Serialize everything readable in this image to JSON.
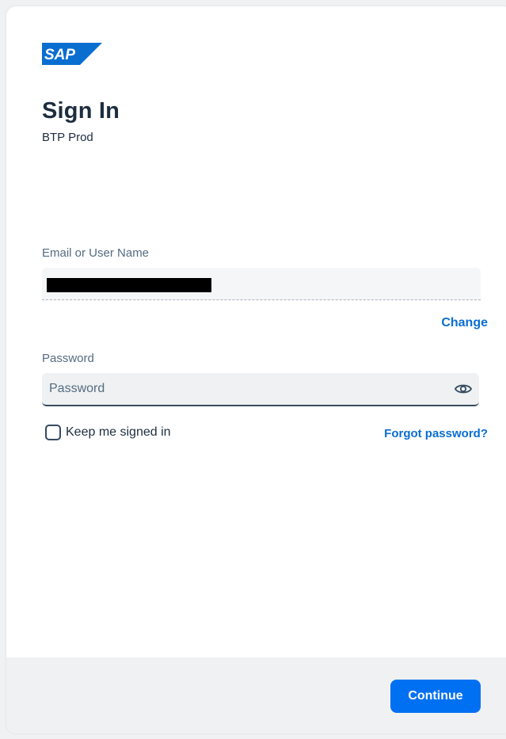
{
  "brand": {
    "logo_text": "SAP",
    "logo_color": "#0a6ed1"
  },
  "header": {
    "title": "Sign In",
    "subtitle": "BTP Prod"
  },
  "form": {
    "email": {
      "label": "Email or User Name",
      "value_redacted": true,
      "change_label": "Change"
    },
    "password": {
      "label": "Password",
      "placeholder": "Password",
      "toggle_icon": "eye-icon"
    },
    "keep_signed_in": {
      "label": "Keep me signed in",
      "checked": false
    },
    "forgot_label": "Forgot password?"
  },
  "footer": {
    "continue_label": "Continue"
  },
  "colors": {
    "accent": "#0070f2",
    "link": "#0a6ed1",
    "text": "#1d2d3e"
  }
}
